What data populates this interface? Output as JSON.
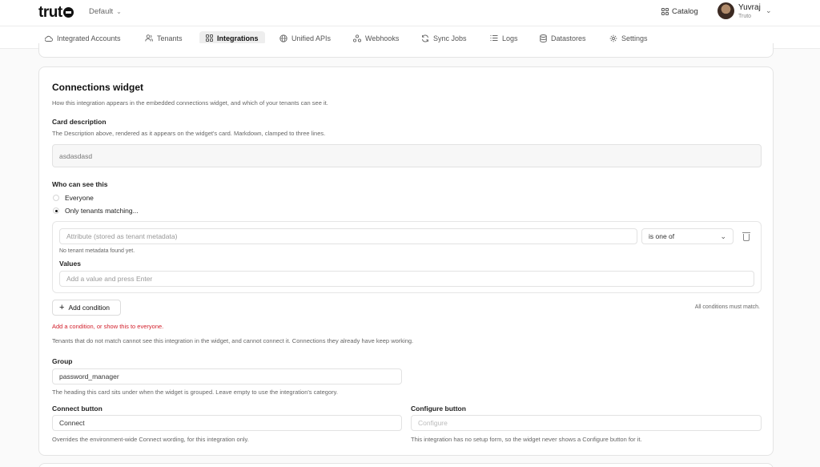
{
  "header": {
    "logo": "trut",
    "environment": "Default",
    "catalog_label": "Catalog",
    "user_name": "Yuvraj",
    "user_org": "Truto"
  },
  "nav": {
    "tabs": [
      {
        "label": "Integrated Accounts",
        "icon": "cloud-icon"
      },
      {
        "label": "Tenants",
        "icon": "users-icon"
      },
      {
        "label": "Integrations",
        "icon": "grid-icon",
        "active": true
      },
      {
        "label": "Unified APIs",
        "icon": "globe-icon"
      },
      {
        "label": "Webhooks",
        "icon": "webhook-icon"
      },
      {
        "label": "Sync Jobs",
        "icon": "sync-icon"
      },
      {
        "label": "Logs",
        "icon": "list-icon"
      },
      {
        "label": "Datastores",
        "icon": "database-icon"
      },
      {
        "label": "Settings",
        "icon": "gear-icon"
      }
    ]
  },
  "widget": {
    "title": "Connections widget",
    "subtitle": "How this integration appears in the embedded connections widget, and which of your tenants can see it.",
    "card_description_label": "Card description",
    "card_description_help": "The Description above, rendered as it appears on the widget's card. Markdown, clamped to three lines.",
    "card_description_value": "asdasdasd",
    "visibility_label": "Who can see this",
    "option_everyone": "Everyone",
    "option_only": "Only tenants matching...",
    "selected_option": "only",
    "attribute_placeholder": "Attribute (stored as tenant metadata)",
    "operator_value": "is one of",
    "no_metadata_note": "No tenant metadata found yet.",
    "values_label": "Values",
    "values_placeholder": "Add a value and press Enter",
    "add_condition_label": "Add condition",
    "all_conditions_note": "All conditions must match.",
    "error_text": "Add a condition, or show this to everyone.",
    "tenants_note": "Tenants that do not match cannot see this integration in the widget, and cannot connect it. Connections they already have keep working.",
    "group_label": "Group",
    "group_value": "password_manager",
    "group_help": "The heading this card sits under when the widget is grouped. Leave empty to use the integration's category.",
    "connect_label": "Connect button",
    "connect_value": "Connect",
    "connect_help": "Overrides the environment-wide Connect wording, for this integration only.",
    "configure_label": "Configure button",
    "configure_placeholder": "Configure",
    "configure_help": "This integration has no setup form, so the widget never shows a Configure button for it."
  },
  "colors": {
    "error": "#d21f2b",
    "active_tab_bg": "#eeeeee"
  }
}
